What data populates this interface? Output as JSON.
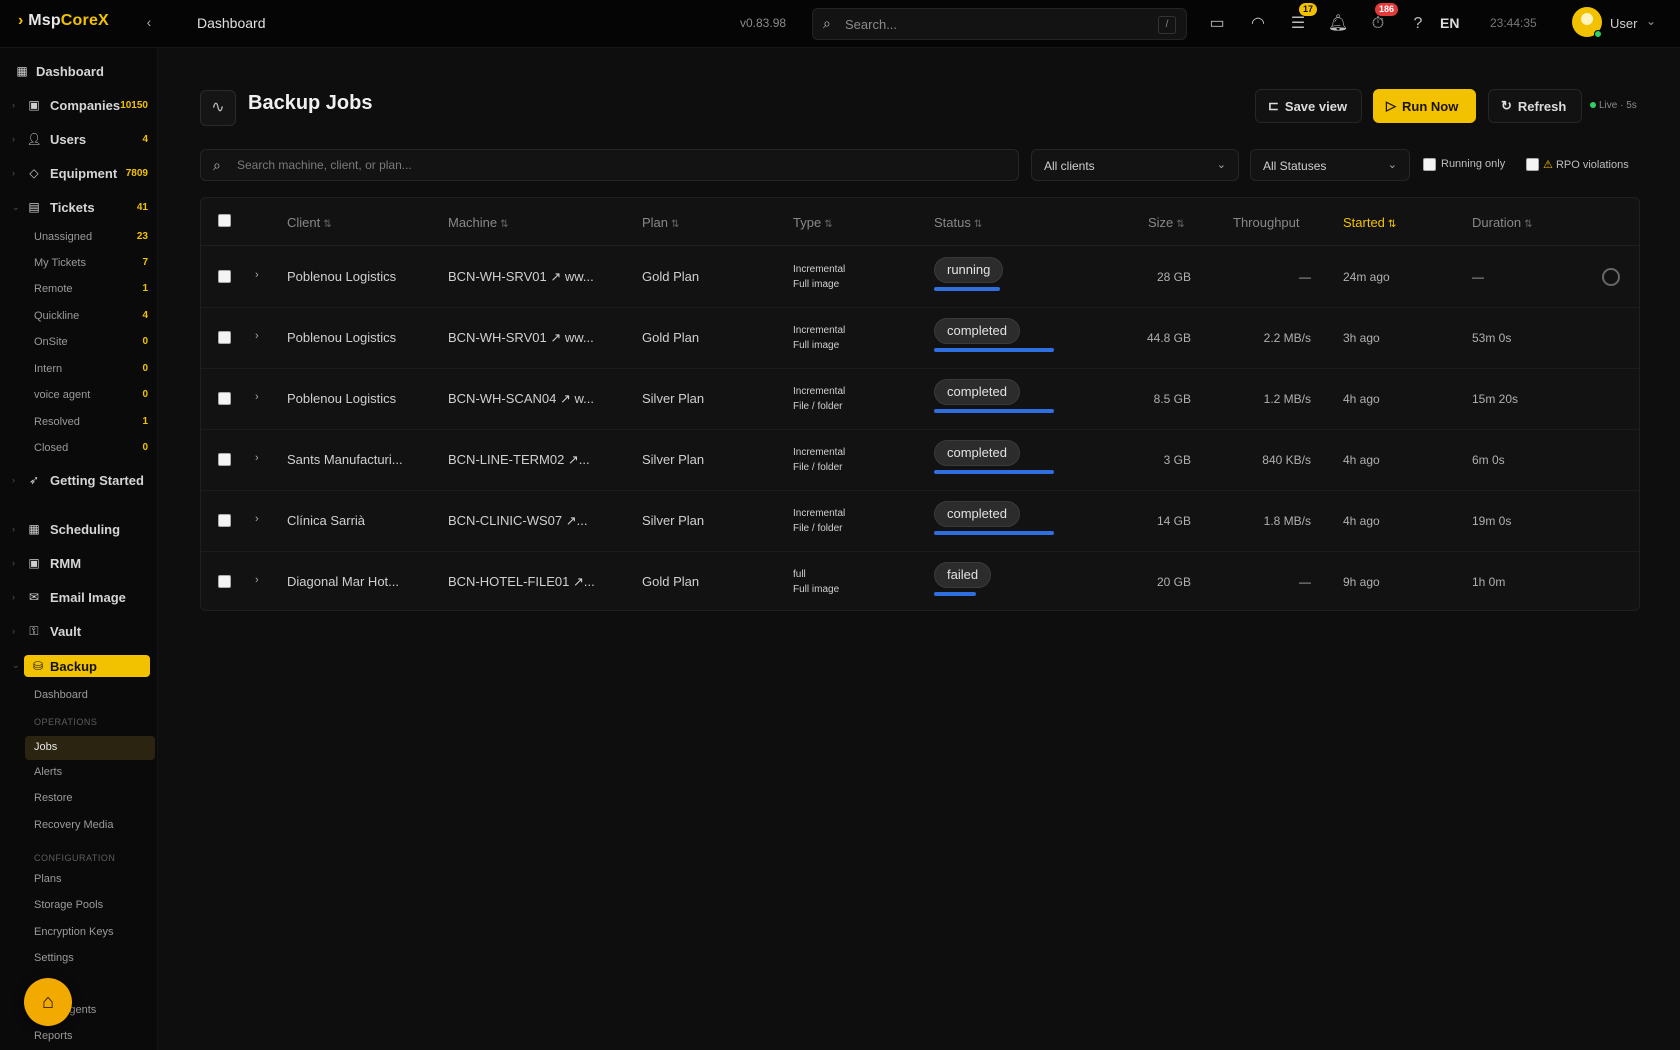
{
  "app": {
    "logo_prefix": "Msp",
    "logo_suffix": "CoreX",
    "top_title": "Dashboard",
    "version": "v0.83.98",
    "search_placeholder": "Search...",
    "search_shortcut": "/",
    "badges": {
      "chat": "17",
      "timer": "186"
    },
    "language": "EN",
    "clock": "23:44:35",
    "user": "User"
  },
  "sidebar": {
    "items": [
      {
        "label": "Dashboard",
        "icon": "grid-icon",
        "count": ""
      },
      {
        "label": "Companies",
        "icon": "building-icon",
        "count": "10150"
      },
      {
        "label": "Users",
        "icon": "users-icon",
        "count": "4"
      },
      {
        "label": "Equipment",
        "icon": "shield-icon",
        "count": "7809"
      },
      {
        "label": "Tickets",
        "icon": "ticket-icon",
        "count": "41"
      }
    ],
    "ticket_subs": [
      {
        "label": "Unassigned",
        "count": "23"
      },
      {
        "label": "My Tickets",
        "count": "7"
      },
      {
        "label": "Remote",
        "count": "1"
      },
      {
        "label": "Quickline",
        "count": "4"
      },
      {
        "label": "OnSite",
        "count": "0"
      },
      {
        "label": "Intern",
        "count": "0"
      },
      {
        "label": "voice agent",
        "count": "0"
      },
      {
        "label": "Resolved",
        "count": "1"
      },
      {
        "label": "Closed",
        "count": "0"
      }
    ],
    "getting_started": "Getting Started",
    "more_items": [
      {
        "label": "Scheduling",
        "icon": "calendar-icon"
      },
      {
        "label": "RMM",
        "icon": "monitor-icon"
      },
      {
        "label": "Email Image",
        "icon": "mail-icon"
      },
      {
        "label": "Vault",
        "icon": "key-icon"
      }
    ],
    "backup": "Backup",
    "backup_subs_top": [
      "Dashboard"
    ],
    "section_operations": "OPERATIONS",
    "operations": [
      "Jobs",
      "Alerts",
      "Restore",
      "Recovery Media"
    ],
    "section_configuration": "CONFIGURATION",
    "configuration": [
      "Plans",
      "Storage Pools",
      "Encryption Keys",
      "Settings"
    ],
    "bottom_items": [
      "Agents",
      "Reports"
    ]
  },
  "page": {
    "title": "Backup Jobs",
    "save_view": "Save view",
    "run_now": "Run Now",
    "refresh": "Refresh",
    "live_label": "Live",
    "live_interval": "5s"
  },
  "filters": {
    "search_placeholder": "Search machine, client, or plan...",
    "client_select": "All clients",
    "status_select": "All Statuses",
    "running_only": "Running only",
    "rpo_violations": "RPO violations"
  },
  "table": {
    "columns": [
      "Client",
      "Machine",
      "Plan",
      "Type",
      "Status",
      "Size",
      "Throughput",
      "Started",
      "Duration"
    ],
    "rows": [
      {
        "client": "Poblenou Logistics",
        "machine": "BCN-WH-SRV01 ↗ ww...",
        "plan": "Gold Plan",
        "type1": "Incremental",
        "type2": "Full image",
        "status": "running",
        "size": "28 GB",
        "throughput": "—",
        "started": "24m ago",
        "duration": "—",
        "progress": 0.55,
        "has_gear": true
      },
      {
        "client": "Poblenou Logistics",
        "machine": "BCN-WH-SRV01 ↗ ww...",
        "plan": "Gold Plan",
        "type1": "Incremental",
        "type2": "Full image",
        "status": "completed",
        "size": "44.8 GB",
        "throughput": "2.2 MB/s",
        "started": "3h ago",
        "duration": "53m 0s",
        "progress": 1.0,
        "has_gear": false
      },
      {
        "client": "Poblenou Logistics",
        "machine": "BCN-WH-SCAN04 ↗ w...",
        "plan": "Silver Plan",
        "type1": "Incremental",
        "type2": "File / folder",
        "status": "completed",
        "size": "8.5 GB",
        "throughput": "1.2 MB/s",
        "started": "4h ago",
        "duration": "15m 20s",
        "progress": 1.0,
        "has_gear": false
      },
      {
        "client": "Sants Manufacturi...",
        "machine": "BCN-LINE-TERM02 ↗...",
        "plan": "Silver Plan",
        "type1": "Incremental",
        "type2": "File / folder",
        "status": "completed",
        "size": "3 GB",
        "throughput": "840 KB/s",
        "started": "4h ago",
        "duration": "6m 0s",
        "progress": 1.0,
        "has_gear": false
      },
      {
        "client": "Clínica Sarrià",
        "machine": "BCN-CLINIC-WS07 ↗...",
        "plan": "Silver Plan",
        "type1": "Incremental",
        "type2": "File / folder",
        "status": "completed",
        "size": "14 GB",
        "throughput": "1.8 MB/s",
        "started": "4h ago",
        "duration": "19m 0s",
        "progress": 1.0,
        "has_gear": false
      },
      {
        "client": "Diagonal Mar Hot...",
        "machine": "BCN-HOTEL-FILE01 ↗...",
        "plan": "Gold Plan",
        "type1": "full",
        "type2": "Full image",
        "status": "failed",
        "size": "20 GB",
        "throughput": "—",
        "started": "9h ago",
        "duration": "1h 0m",
        "progress": 0.35,
        "has_gear": false
      }
    ]
  },
  "colors": {
    "accent": "#f2c200",
    "progress": "#2f6fe0",
    "online": "#2fd066",
    "alert": "#e23b3b"
  }
}
